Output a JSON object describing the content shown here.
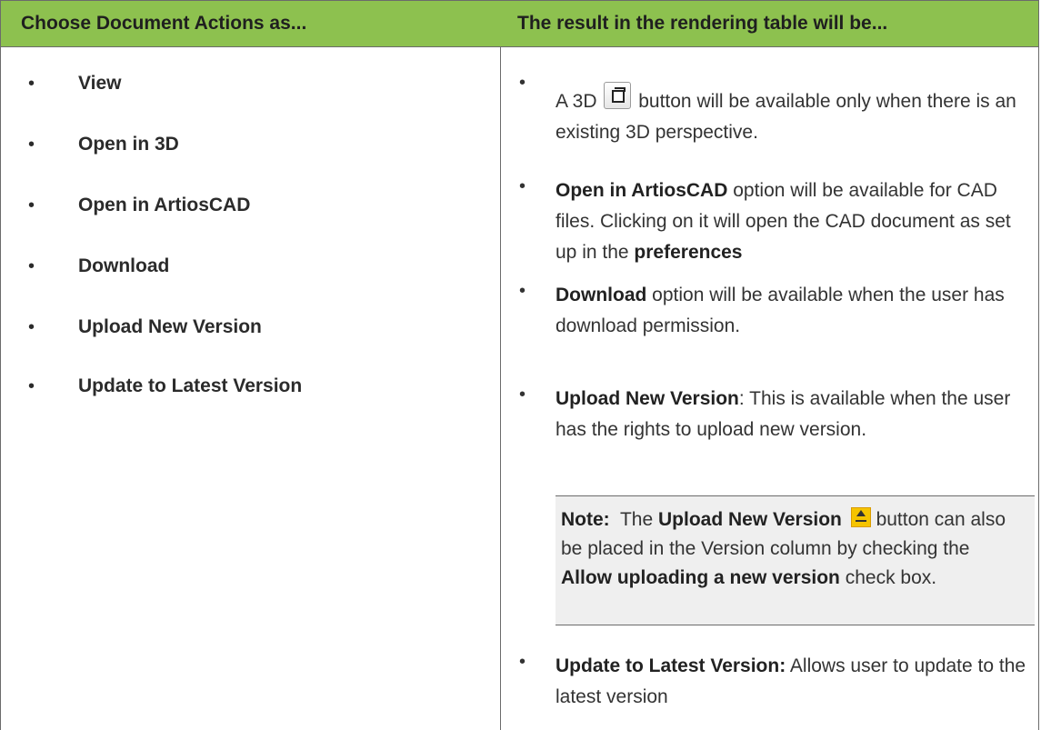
{
  "table": {
    "headers": {
      "left": "Choose Document Actions as...",
      "right": "The result in the rendering table will be..."
    },
    "actions": [
      "View",
      "Open in 3D",
      "Open in ArtiosCAD",
      "Download",
      "Upload New Version",
      "Update to Latest Version"
    ],
    "results": {
      "r1": {
        "pre": "A 3D",
        "icon": "3d-view-icon",
        "post": "button will be available only when there is an existing 3D perspective."
      },
      "r2": {
        "bold1": "Open in ArtiosCAD",
        "text1": "option will be available for CAD files. Clicking on it will open the CAD document as set up in the",
        "bold2": "preferences"
      },
      "r3": {
        "bold": "Download",
        "text": "option will be available when the user has download permission."
      },
      "r4": {
        "bold": "Upload New Version",
        "text": ": This is available when the user has the rights to upload new version."
      },
      "note": {
        "label": "Note:",
        "pre": "The",
        "bold1": "Upload New Version",
        "icon": "upload-icon",
        "text1": "button can also be placed in the Version column by checking the",
        "bold2": "Allow uploading a new version",
        "text2": "check box."
      },
      "r5": {
        "bold": "Update to Latest Version:",
        "text": "Allows user to update to the latest version"
      }
    },
    "bullet_char": "•",
    "colors": {
      "header_bg": "#8dc14f",
      "note_bg": "#efefef",
      "border": "#6b6b6b"
    }
  }
}
